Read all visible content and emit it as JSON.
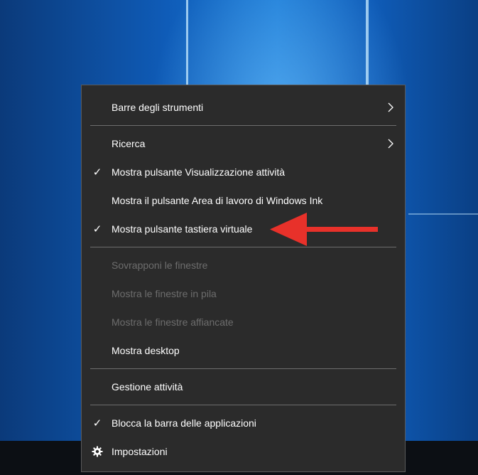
{
  "menu": {
    "items": [
      {
        "label": "Barre degli strumenti",
        "submenu": true,
        "checked": false,
        "enabled": true
      },
      {
        "label": "Ricerca",
        "submenu": true,
        "checked": false,
        "enabled": true
      },
      {
        "label": "Mostra pulsante Visualizzazione attività",
        "submenu": false,
        "checked": true,
        "enabled": true
      },
      {
        "label": "Mostra il pulsante Area di lavoro di Windows Ink",
        "submenu": false,
        "checked": false,
        "enabled": true
      },
      {
        "label": "Mostra pulsante tastiera virtuale",
        "submenu": false,
        "checked": true,
        "enabled": true
      },
      {
        "label": "Sovrapponi le finestre",
        "submenu": false,
        "checked": false,
        "enabled": false
      },
      {
        "label": "Mostra le finestre in pila",
        "submenu": false,
        "checked": false,
        "enabled": false
      },
      {
        "label": "Mostra le finestre affiancate",
        "submenu": false,
        "checked": false,
        "enabled": false
      },
      {
        "label": "Mostra desktop",
        "submenu": false,
        "checked": false,
        "enabled": true
      },
      {
        "label": "Gestione attività",
        "submenu": false,
        "checked": false,
        "enabled": true
      },
      {
        "label": "Blocca la barra delle applicazioni",
        "submenu": false,
        "checked": true,
        "enabled": true
      },
      {
        "label": "Impostazioni",
        "submenu": false,
        "checked": false,
        "enabled": true,
        "icon": "gear-icon"
      }
    ],
    "check_glyph": "✓"
  },
  "annotation": {
    "color": "#e8312a",
    "icon": "red-arrow-icon"
  },
  "colors": {
    "menu_bg": "#2b2b2b",
    "text": "#ffffff",
    "disabled_text": "#6d6d6d",
    "separator": "#6e6e6e"
  }
}
